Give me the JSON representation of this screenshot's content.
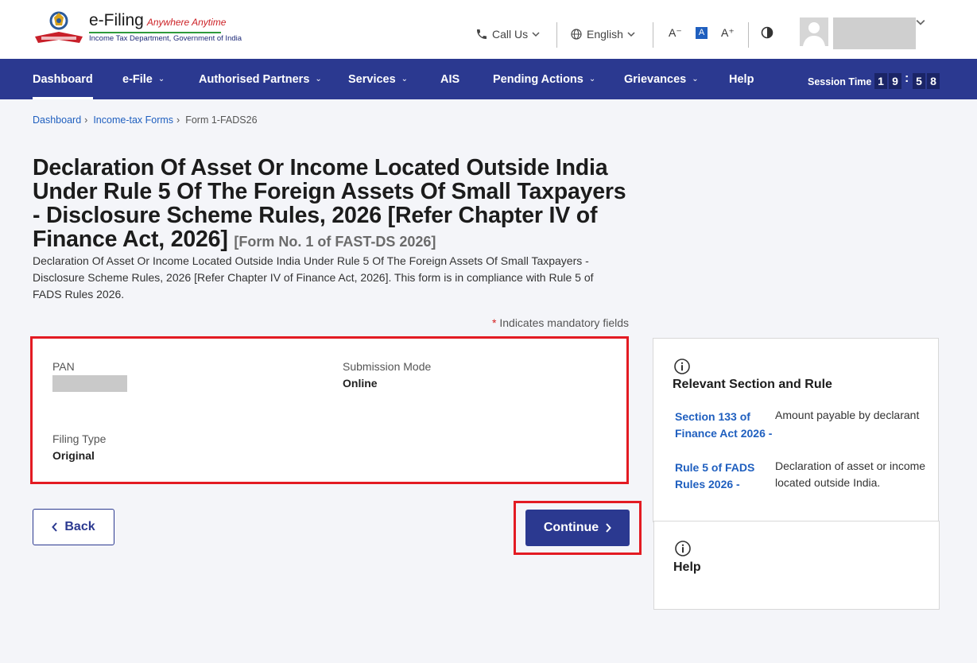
{
  "header": {
    "brand_name": "e-Filing",
    "brand_tagline": "Anywhere Anytime",
    "department": "Income Tax Department, Government of India",
    "call_us": "Call Us",
    "language": "English",
    "font_decrease": "A⁻",
    "font_normal": "A",
    "font_increase": "A⁺"
  },
  "nav": {
    "items": [
      {
        "label": "Dashboard"
      },
      {
        "label": "e-File"
      },
      {
        "label": "Authorised Partners"
      },
      {
        "label": "Services"
      },
      {
        "label": "AIS"
      },
      {
        "label": "Pending Actions"
      },
      {
        "label": "Grievances"
      },
      {
        "label": "Help"
      }
    ],
    "session_label": "Session Time",
    "session_digits": [
      "1",
      "9",
      "5",
      "8"
    ]
  },
  "breadcrumb": {
    "items": [
      "Dashboard",
      "Income-tax Forms"
    ],
    "current": "Form 1-FADS26"
  },
  "page": {
    "title": "Declaration Of Asset Or Income Located Outside India Under Rule 5 Of The Foreign Assets Of Small Taxpayers - Disclosure Scheme Rules, 2026 [Refer Chapter IV of Finance Act, 2026]",
    "title_sub": "[Form No. 1 of FAST-DS 2026]",
    "description": "Declaration Of Asset Or Income Located Outside India Under Rule 5 Of The Foreign Assets Of Small Taxpayers - Disclosure Scheme Rules, 2026 [Refer Chapter IV of Finance Act, 2026]. This form is in compliance with Rule 5 of FADS Rules 2026.",
    "mandatory_star": "*",
    "mandatory_text": "Indicates mandatory fields"
  },
  "form": {
    "pan_label": "PAN",
    "submission_mode_label": "Submission Mode",
    "submission_mode_value": "Online",
    "filing_type_label": "Filing Type",
    "filing_type_value": "Original"
  },
  "actions": {
    "back_label": "Back",
    "continue_label": "Continue"
  },
  "side": {
    "section_title": "Relevant Section and Rule",
    "rules": [
      {
        "link": "Section 133 of Finance Act 2026 -",
        "desc": "Amount payable by declarant"
      },
      {
        "link": "Rule 5 of FADS Rules 2026 -",
        "desc": "Declaration of asset or income located outside India."
      }
    ],
    "help_title": "Help"
  },
  "colors": {
    "primary": "#2b3990",
    "link": "#1f5fbf",
    "highlight": "#e31b23"
  }
}
